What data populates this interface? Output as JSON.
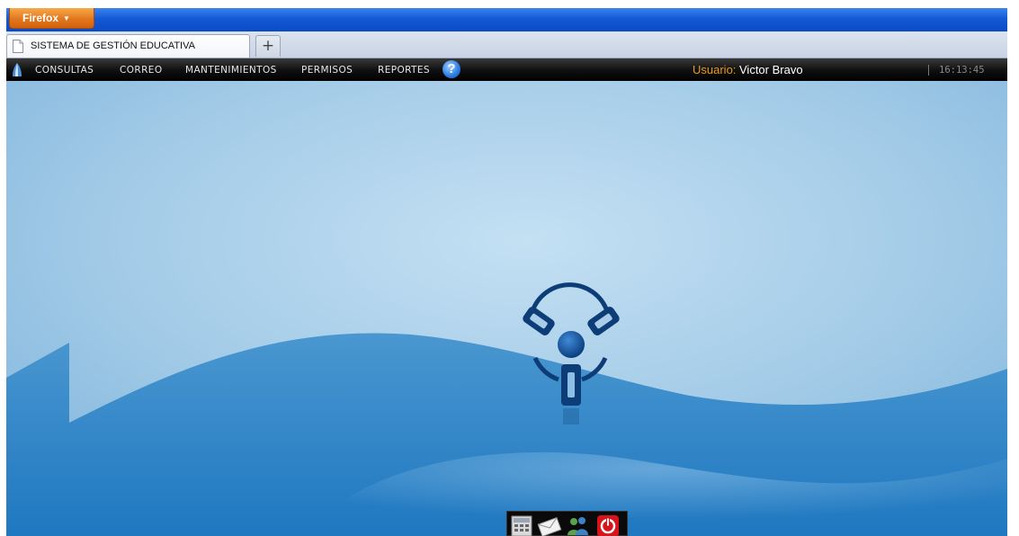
{
  "browser": {
    "menu_button_label": "Firefox",
    "tab_title": "SISTEMA DE GESTIÓN EDUCATIVA",
    "new_tab_label": "+"
  },
  "menubar": {
    "items": [
      {
        "label": "CONSULTAS"
      },
      {
        "label": "CORREO"
      },
      {
        "label": "MANTENIMIENTOS"
      },
      {
        "label": "PERMISOS"
      },
      {
        "label": "REPORTES"
      }
    ],
    "help_label": "?",
    "user_label": "Usuario:",
    "user_name": "Victor Bravo",
    "clock": "16:13:45"
  },
  "dock": {
    "icons": [
      "calculator-icon",
      "mail-icon",
      "users-icon",
      "power-icon"
    ]
  },
  "colors": {
    "titlebar": "#1459d4",
    "menu_button": "#e3761d",
    "menubar": "#000000",
    "user_label": "#e89a1f",
    "desktop_light": "#a9cde8",
    "desktop_dark": "#1f7fc2",
    "logo": "#0d3d77"
  }
}
